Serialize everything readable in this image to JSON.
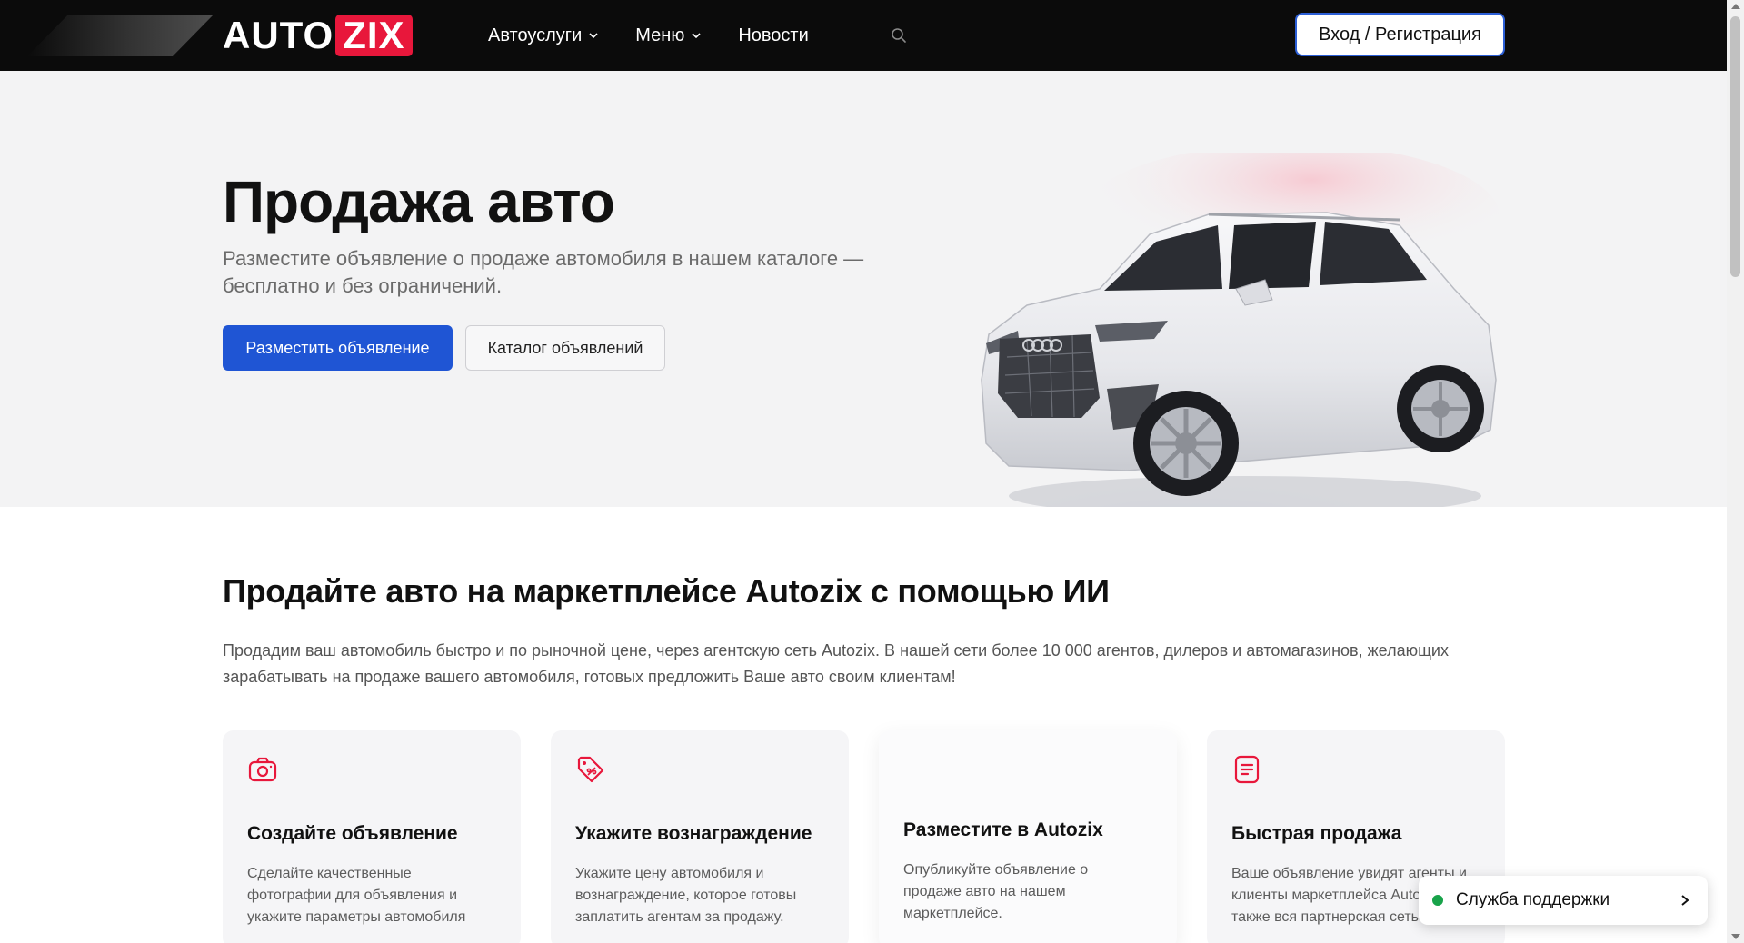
{
  "header": {
    "logo_auto": "AUTO",
    "logo_zix": "ZIX",
    "nav": [
      {
        "label": "Автоуслуги",
        "has_dropdown": true
      },
      {
        "label": "Меню",
        "has_dropdown": true
      },
      {
        "label": "Новости",
        "has_dropdown": false
      }
    ],
    "search_icon": "search-icon",
    "login_label": "Вход / Регистрация"
  },
  "hero": {
    "title": "Продажа авто",
    "subtitle": "Разместите объявление о продаже автомобиля в нашем каталоге — бесплатно и без ограничений.",
    "primary_button": "Разместить объявление",
    "secondary_button": "Каталог объявлений"
  },
  "section": {
    "title": "Продайте авто на маркетплейсе Autozix с помощью ИИ",
    "text": "Продадим ваш автомобиль быстро и по рыночной цене, через агентскую сеть Autozix. В нашей сети более 10 000 агентов, дилеров и автомагазинов, желающих зарабатывать на продаже вашего автомобиля, готовых предложить Ваше авто своим клиентам!"
  },
  "cards": [
    {
      "icon": "camera-icon",
      "title": "Создайте объявление",
      "text": "Сделайте качественные фотографии для объявления и укажите параметры автомобиля"
    },
    {
      "icon": "price-tag-icon",
      "title": "Укажите вознаграждение",
      "text": "Укажите цену автомобиля и вознаграждение, которое готовы заплатить агентам за продажу."
    },
    {
      "icon": "",
      "title": "Разместите в Autozix",
      "text": "Опубликуйте объявление о продаже авто на нашем маркетплейсе."
    },
    {
      "icon": "document-icon",
      "title": "Быстрая продажа",
      "text": "Ваше объявление увидят агенты и клиенты маркетплейса Autozix, а также вся партнерская сеть"
    }
  ],
  "support": {
    "label": "Служба поддержки",
    "status_color": "#18a34a"
  },
  "colors": {
    "brand_red": "#e8173b",
    "primary_blue": "#1f55d4",
    "header_bg": "#0b0b0b",
    "hero_bg": "#f3f3f4"
  }
}
